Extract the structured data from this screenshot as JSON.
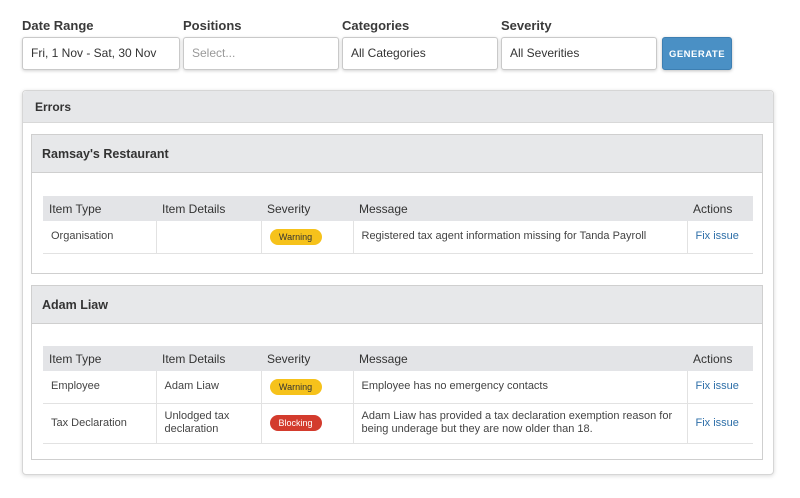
{
  "filters": {
    "date_range": {
      "label": "Date Range",
      "value": "Fri, 1 Nov - Sat, 30 Nov"
    },
    "positions": {
      "label": "Positions",
      "placeholder": "Select..."
    },
    "categories": {
      "label": "Categories",
      "value": "All Categories"
    },
    "severity": {
      "label": "Severity",
      "value": "All Severities"
    },
    "generate_label": "GENERATE"
  },
  "errors_panel": {
    "title": "Errors",
    "columns": [
      "Item Type",
      "Item Details",
      "Severity",
      "Message",
      "Actions"
    ],
    "groups": [
      {
        "name": "Ramsay's Restaurant",
        "rows": [
          {
            "item_type": "Organisation",
            "item_details": "",
            "severity": "Warning",
            "message": "Registered tax agent information missing for Tanda Payroll",
            "action": "Fix issue"
          }
        ]
      },
      {
        "name": "Adam Liaw",
        "rows": [
          {
            "item_type": "Employee",
            "item_details": "Adam Liaw",
            "severity": "Warning",
            "message": "Employee has no emergency contacts",
            "action": "Fix issue"
          },
          {
            "item_type": "Tax Declaration",
            "item_details": "Unlodged tax declaration",
            "severity": "Blocking",
            "message": "Adam Liaw has provided a tax declaration exemption reason for being underage but they are now older than 18.",
            "action": "Fix issue"
          }
        ]
      }
    ]
  },
  "colors": {
    "accent": "#4a90c5",
    "warning": "#f6c21b",
    "blocking": "#d33b2d",
    "link": "#2e6fa8"
  }
}
